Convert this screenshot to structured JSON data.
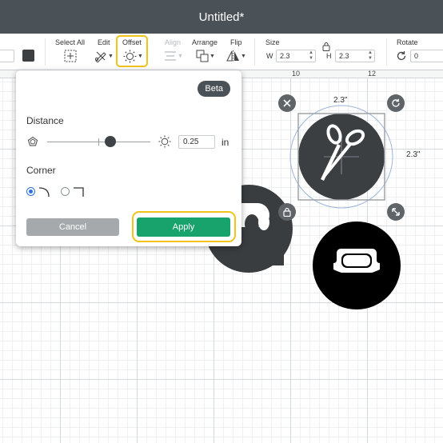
{
  "window": {
    "title": "Untitled*"
  },
  "toolbar": {
    "select_all_label": "Select All",
    "edit_label": "Edit",
    "offset_label": "Offset",
    "align_label": "Align",
    "arrange_label": "Arrange",
    "flip_label": "Flip",
    "size_label": "Size",
    "rotate_label": "Rotate",
    "width_letter": "W",
    "width_value": "2.3",
    "height_letter": "H",
    "height_value": "2.3",
    "rotate_value": "0",
    "highlight_color": "#f2c31a"
  },
  "ruler": {
    "marks": [
      "10",
      "12"
    ]
  },
  "offset_panel": {
    "badge": "Beta",
    "distance_label": "Distance",
    "distance_value": "0.25",
    "distance_unit": "in",
    "distance_slider_level": 0.6,
    "corner_label": "Corner",
    "corner_options": [
      "rounded-corner-icon",
      "square-corner-icon"
    ],
    "corner_selected": "rounded-corner-icon",
    "cancel_label": "Cancel",
    "apply_label": "Apply",
    "apply_color": "#17a36b"
  },
  "selection": {
    "width_readout": "2.3\"",
    "height_readout": "2.3\""
  },
  "canvas_objects": [
    "scissors-circle-design",
    "rounded-image-circle-design",
    "partial-dark-design"
  ]
}
